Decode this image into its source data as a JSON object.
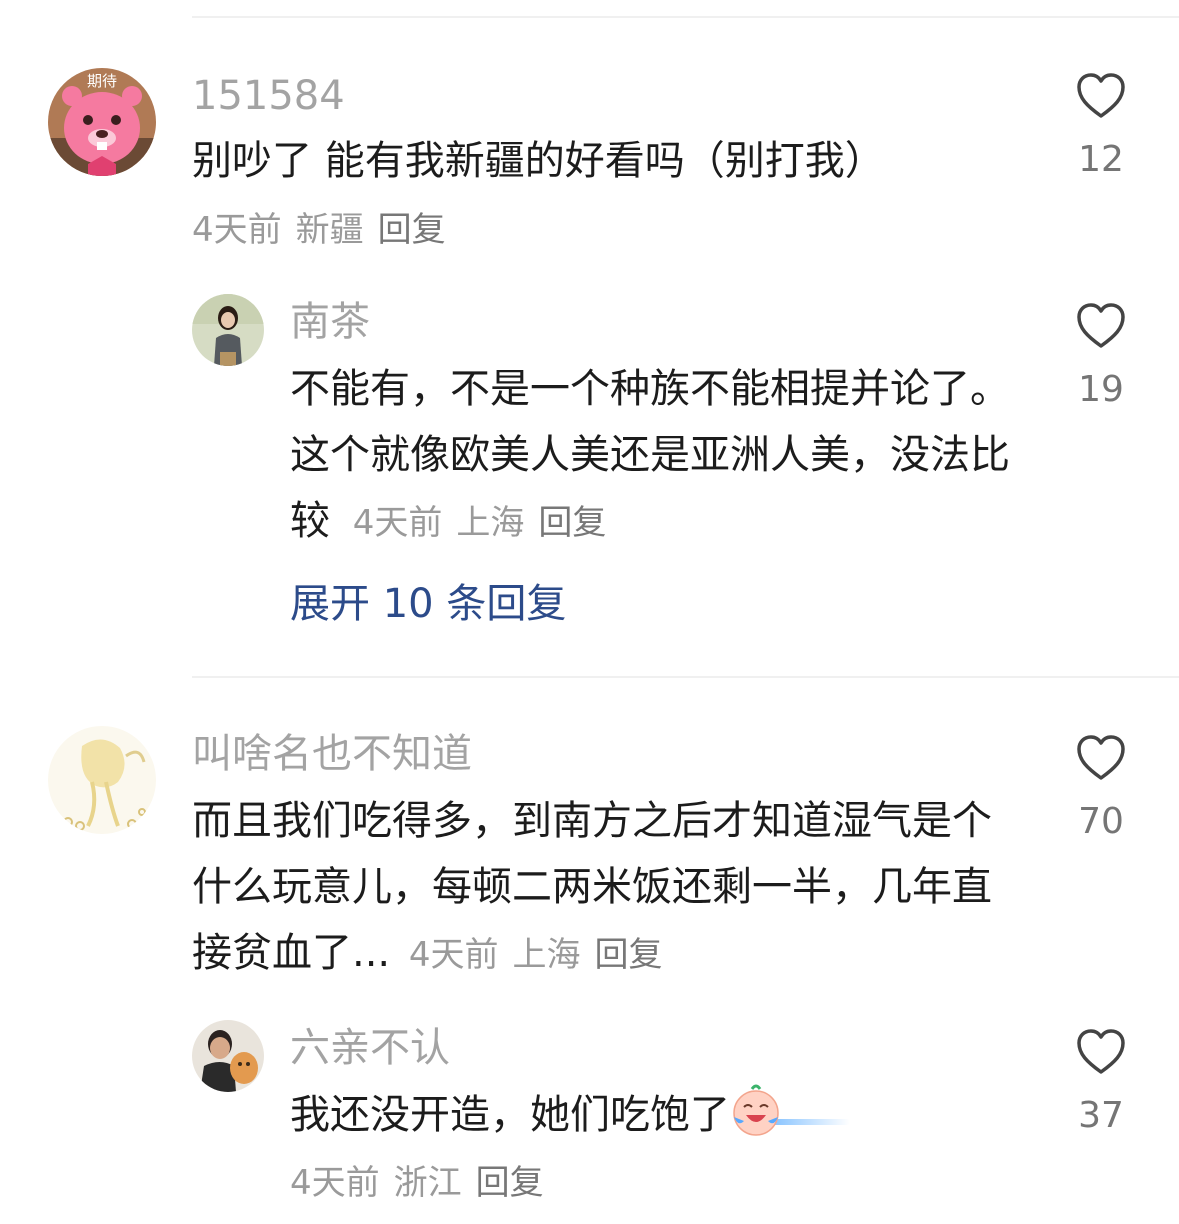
{
  "comments": [
    {
      "username": "151584",
      "avatar_badge": "期待",
      "text": "别吵了 能有我新疆的好看吗（别打我）",
      "time": "4天前",
      "location": "新疆",
      "reply_label": "回复",
      "likes": "12",
      "replies": [
        {
          "username": "南茶",
          "text": "不能有，不是一个种族不能相提并论了。这个就像欧美人美还是亚洲人美，没法比较",
          "time": "4天前",
          "location": "上海",
          "reply_label": "回复",
          "likes": "19"
        }
      ],
      "expand_label": "展开 10 条回复"
    },
    {
      "username": "叫啥名也不知道",
      "text": "而且我们吃得多，到南方之后才知道湿气是个什么玩意儿，每顿二两米饭还剩一半，几年直接贫血了...",
      "time": "4天前",
      "location": "上海",
      "reply_label": "回复",
      "likes": "70",
      "replies": [
        {
          "username": "六亲不认",
          "text": "我还没开造，她们吃饱了",
          "emoji": "crying-laughing-face-emoji",
          "time": "4天前",
          "location": "浙江",
          "reply_label": "回复",
          "likes": "37"
        }
      ]
    }
  ],
  "colors": {
    "username": "#a3a3a3",
    "body_text": "#1c1c1c",
    "meta": "#9a9a9a",
    "expand_link": "#2c4b8a",
    "heart_outline": "#444444"
  },
  "icons": {
    "like": "heart-outline-icon"
  }
}
